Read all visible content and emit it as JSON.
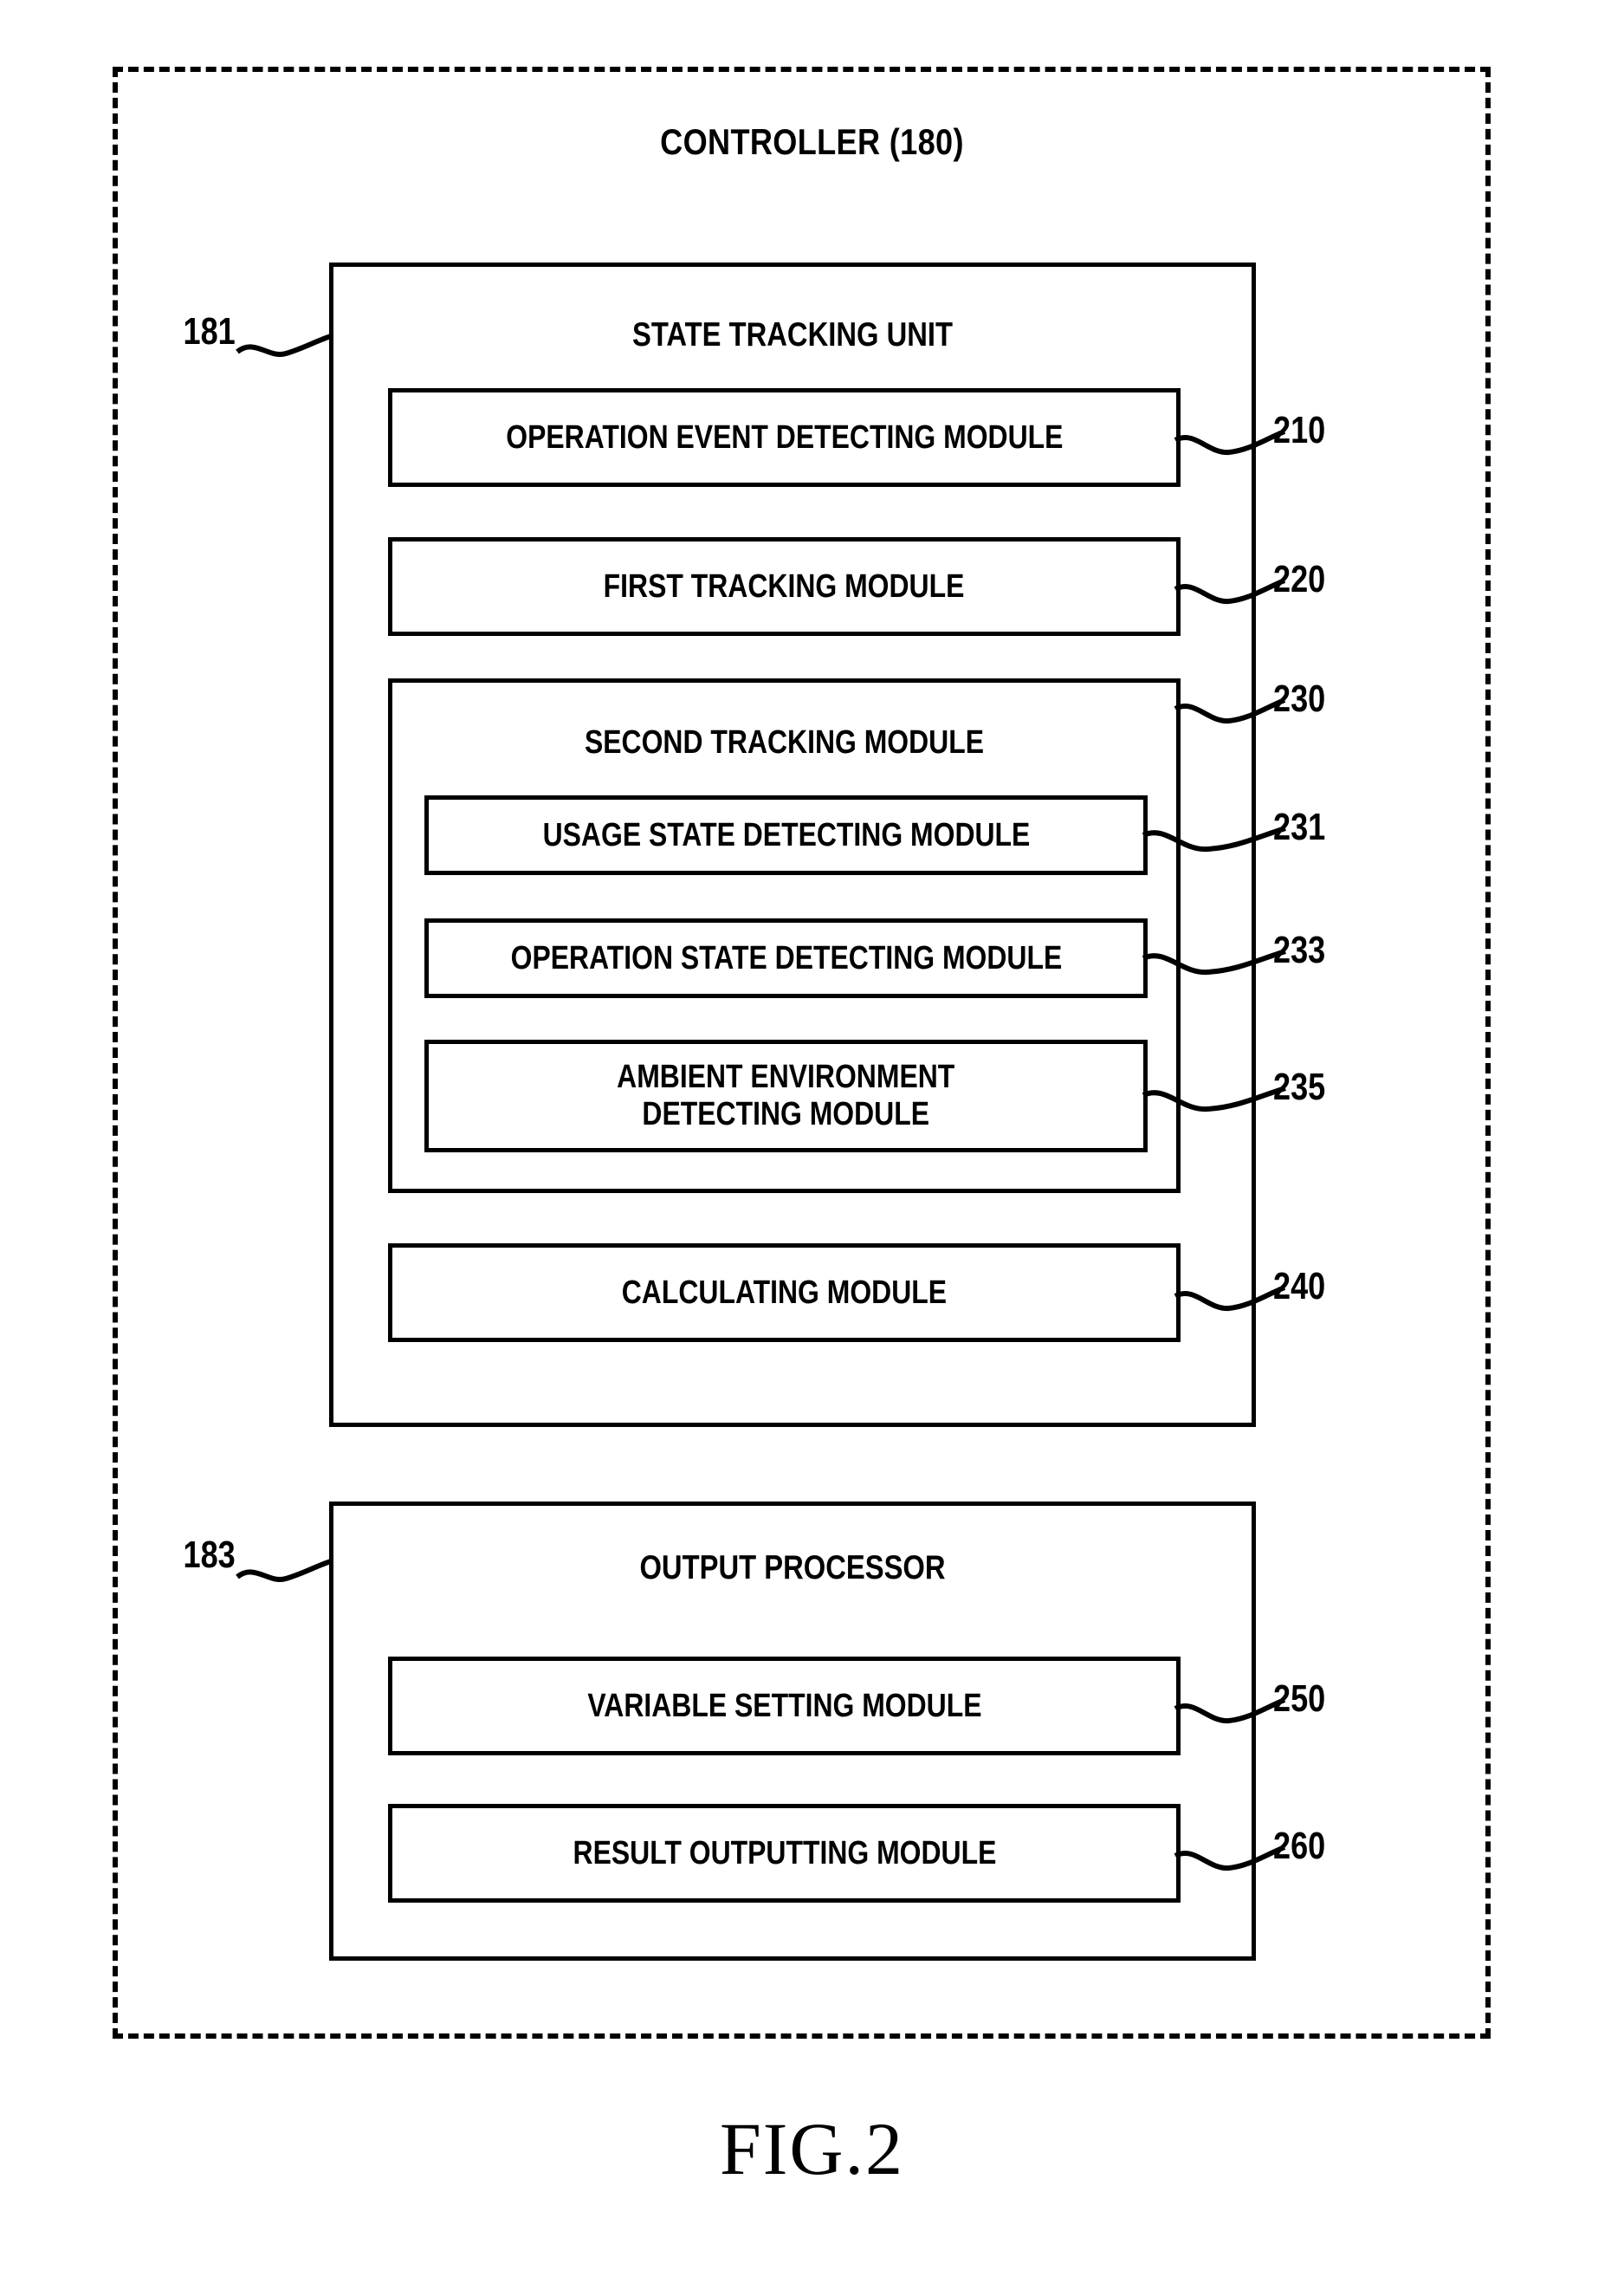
{
  "figure": {
    "caption": "FIG.2",
    "controller_title": "CONTROLLER (180)"
  },
  "units": [
    {
      "id": "state-tracking-unit",
      "title": "STATE TRACKING UNIT",
      "ref": "181"
    },
    {
      "id": "output-processor",
      "title": "OUTPUT PROCESSOR",
      "ref": "183"
    }
  ],
  "modules": {
    "operation_event_detecting": {
      "label": "OPERATION EVENT DETECTING MODULE",
      "ref": "210"
    },
    "first_tracking": {
      "label": "FIRST TRACKING MODULE",
      "ref": "220"
    },
    "second_tracking": {
      "label": "SECOND TRACKING MODULE",
      "ref": "230"
    },
    "usage_state_detecting": {
      "label": "USAGE STATE DETECTING MODULE",
      "ref": "231"
    },
    "operation_state_detecting": {
      "label": "OPERATION STATE DETECTING MODULE",
      "ref": "233"
    },
    "ambient_environment_detecting": {
      "label": "AMBIENT ENVIRONMENT\nDETECTING MODULE",
      "ref": "235"
    },
    "calculating": {
      "label": "CALCULATING MODULE",
      "ref": "240"
    },
    "variable_setting": {
      "label": "VARIABLE SETTING MODULE",
      "ref": "250"
    },
    "result_outputting": {
      "label": "RESULT OUTPUTTING MODULE",
      "ref": "260"
    }
  },
  "colors": {
    "line": "#000000",
    "background": "#ffffff"
  }
}
